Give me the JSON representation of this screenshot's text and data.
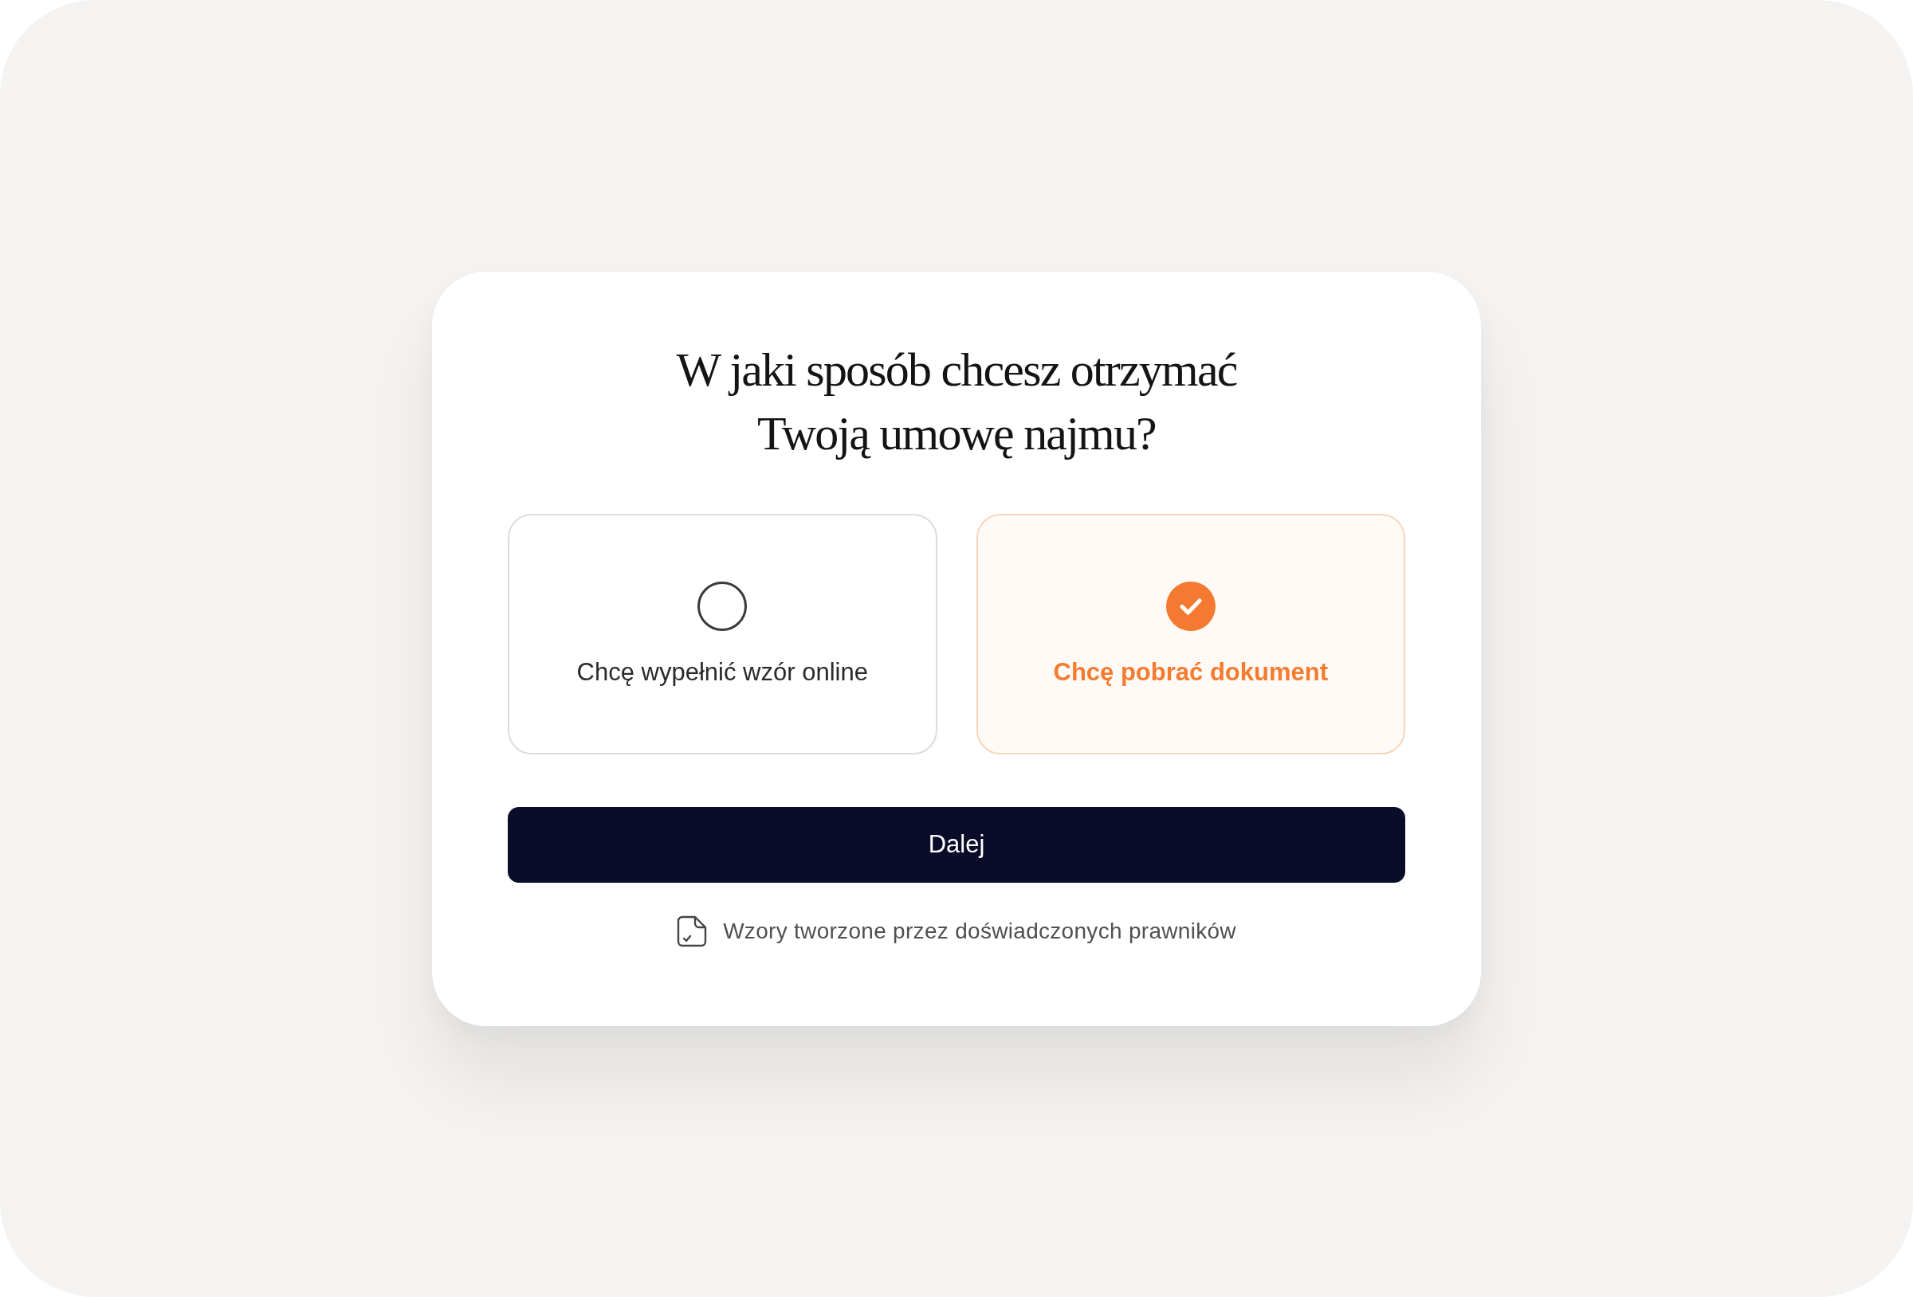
{
  "question": {
    "lines": [
      "W jaki sposób chcesz otrzymać",
      "Twoją umowę najmu?"
    ]
  },
  "options": [
    {
      "label": "Chcę wypełnić wzór online",
      "selected": false
    },
    {
      "label": "Chcę pobrać dokument",
      "selected": true
    }
  ],
  "next_button": {
    "label": "Dalej"
  },
  "footer_note": {
    "text": "Wzory tworzone przez doświadczonych prawników"
  }
}
